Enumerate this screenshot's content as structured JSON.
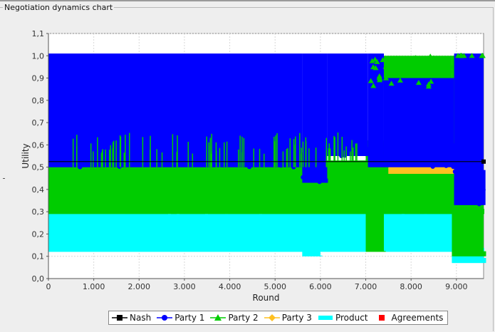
{
  "window": {
    "title": "Negotiation dynamics chart"
  },
  "chart_data": {
    "type": "scatter",
    "xlabel": "Round",
    "ylabel": "Utility",
    "xlim": [
      0,
      9600
    ],
    "ylim": [
      0,
      1.1
    ],
    "x_ticks": [
      0,
      1000,
      2000,
      3000,
      4000,
      5000,
      6000,
      7000,
      8000,
      9000
    ],
    "x_tick_labels": [
      "0",
      "1.000",
      "2.000",
      "3.000",
      "4.000",
      "5.000",
      "6.000",
      "7.000",
      "8.000",
      "9.000"
    ],
    "y_ticks": [
      0,
      0.1,
      0.2,
      0.3,
      0.4,
      0.5,
      0.6,
      0.7,
      0.8,
      0.9,
      1.0,
      1.1
    ],
    "y_tick_labels": [
      "0,0",
      "0,1",
      "0,2",
      "0,3",
      "0,4",
      "0,5",
      "0,6",
      "0,7",
      "0,8",
      "0,9",
      "1,0",
      "1,1"
    ],
    "grid": true,
    "legend_position": "bottom",
    "nash": {
      "y": 0.525
    },
    "series": [
      {
        "name": "Product",
        "color": "#00ffff",
        "segments": [
          [
            0,
            9600,
            0.12,
            0.29,
            0.13
          ],
          [
            1700,
            5600,
            0.17,
            0.29,
            0.17
          ],
          [
            5600,
            6000,
            0.1,
            0.29,
            0.1
          ],
          [
            6000,
            7400,
            0.15,
            0.29,
            0.15
          ],
          [
            7400,
            8900,
            0.25,
            0.47,
            0.25
          ],
          [
            8900,
            9600,
            0.07,
            0.47,
            0.07
          ]
        ]
      },
      {
        "name": "Party 2",
        "color": "#00cc00",
        "segments": [
          [
            0,
            9600,
            0.29,
            0.53,
            0.29
          ],
          [
            7000,
            7400,
            0.12,
            0.62,
            0.12
          ],
          [
            7400,
            8900,
            0.47,
            1.0,
            0.47
          ],
          [
            8900,
            9600,
            0.1,
            1.0,
            0.1
          ]
        ]
      },
      {
        "name": "Party 3",
        "color": "#ffc020",
        "segments": [
          [
            7500,
            8950,
            0.47,
            0.51,
            0.47
          ]
        ]
      },
      {
        "name": "Party 1",
        "color": "#0000ff",
        "segments": [
          [
            0,
            5600,
            0.5,
            1.01,
            0.53
          ],
          [
            5600,
            6150,
            0.43,
            1.01,
            0.43
          ],
          [
            6150,
            7050,
            0.55,
            1.01,
            0.55
          ],
          [
            7050,
            7400,
            0.5,
            1.01,
            0.55
          ],
          [
            7400,
            8950,
            0.5,
            0.9,
            0.6
          ],
          [
            8950,
            9600,
            0.33,
            1.01,
            0.45
          ]
        ]
      }
    ],
    "agreements": []
  },
  "legend": {
    "items": [
      {
        "label": "Nash",
        "color": "#000000",
        "marker": "square"
      },
      {
        "label": "Party 1",
        "color": "#0000ff",
        "marker": "circle"
      },
      {
        "label": "Party 2",
        "color": "#00cc00",
        "marker": "triangle"
      },
      {
        "label": "Party 3",
        "color": "#ffc020",
        "marker": "diamond"
      },
      {
        "label": "Product",
        "color": "#00ffff",
        "marker": "rect"
      },
      {
        "label": "Agreements",
        "color": "#ff0000",
        "marker": "square"
      }
    ]
  }
}
